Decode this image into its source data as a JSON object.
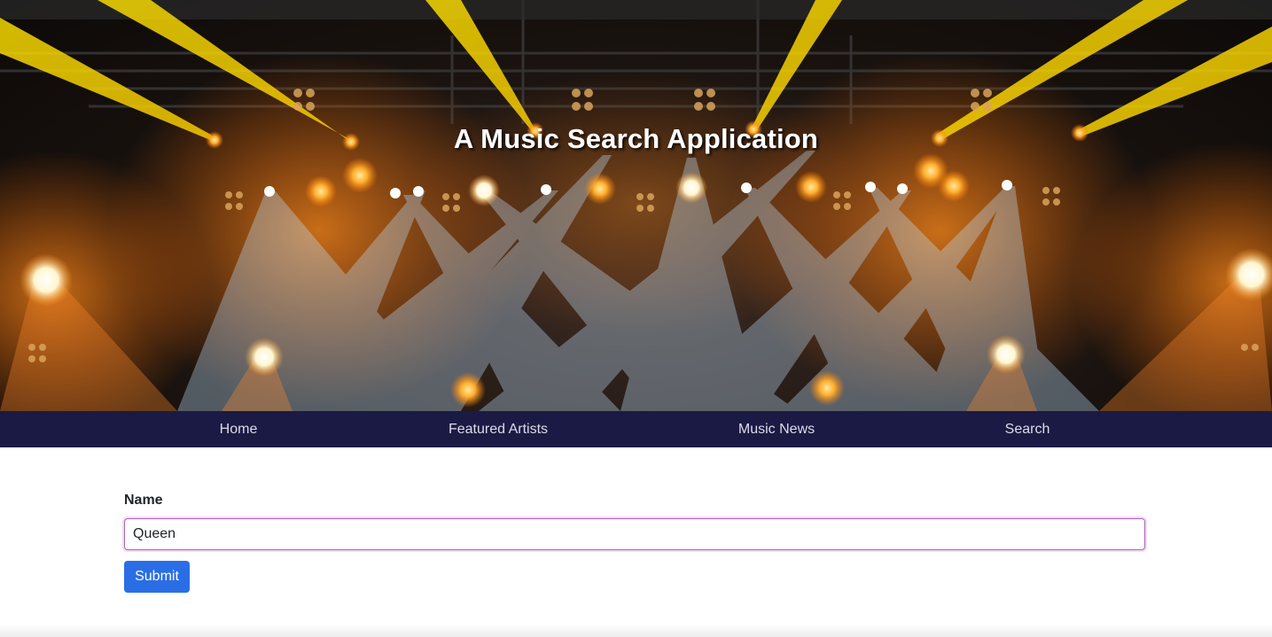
{
  "hero": {
    "title": "A Music Search Application",
    "background": "concert stage lights"
  },
  "nav": {
    "items": [
      {
        "label": "Home"
      },
      {
        "label": "Featured Artists"
      },
      {
        "label": "Music News"
      },
      {
        "label": "Search"
      }
    ],
    "color": "#1b1a45"
  },
  "form": {
    "name_label": "Name",
    "name_value": "Queen",
    "submit_label": "Submit"
  },
  "colors": {
    "accent": "#2a6ee6",
    "focus_border": "#b060c0"
  }
}
